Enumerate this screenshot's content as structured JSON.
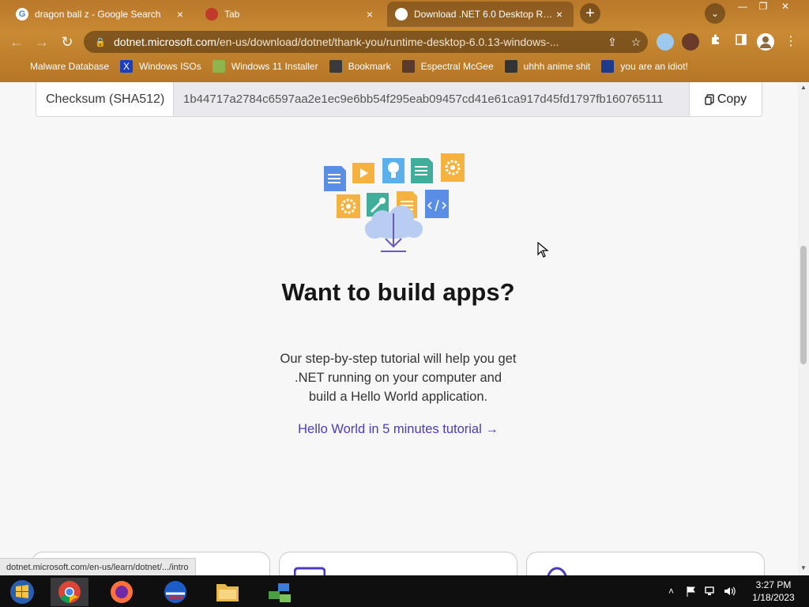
{
  "browser": {
    "tabs": [
      {
        "title": "dragon ball z - Google Search",
        "close": "×",
        "favicon": "google-icon"
      },
      {
        "title": "Tab",
        "close": "×",
        "favicon": "generic-site-icon"
      },
      {
        "title": "Download .NET 6.0 Desktop Runtim",
        "close": "×",
        "favicon": "microsoft-icon",
        "active": true
      }
    ],
    "new_tab": "+",
    "tab_search": "⌄",
    "window_controls": {
      "minimize": "—",
      "restore": "❐",
      "close": "✕"
    },
    "nav": {
      "back": "←",
      "forward": "→",
      "reload": "↻"
    },
    "address": {
      "domain": "dotnet.microsoft.com",
      "path": "/en-us/download/dotnet/thank-you/runtime-desktop-6.0.13-windows-..."
    },
    "omnibox_icons": {
      "share": "⇪",
      "star": "☆"
    },
    "bookmarks": [
      {
        "label": "Malware Database"
      },
      {
        "label": "Windows ISOs"
      },
      {
        "label": "Windows 11 Installer"
      },
      {
        "label": "Bookmark"
      },
      {
        "label": "Espectral McGee"
      },
      {
        "label": "uhhh anime shit"
      },
      {
        "label": "you are an idiot!"
      }
    ]
  },
  "page": {
    "checksum": {
      "label": "Checksum (SHA512)",
      "value": "1b44717a2784c6597aa2e1ec9e6bb54f295eab09457cd41e61ca917d45fd1797fb160765111",
      "copy_label": "Copy"
    },
    "headline": "Want to build apps?",
    "body": "Our step-by-step tutorial will help you get .NET running on your computer and build a Hello World application.",
    "tutorial_link": "Hello World in 5 minutes tutorial →"
  },
  "status_url": "dotnet.microsoft.com/en-us/learn/dotnet/.../intro",
  "taskbar": {
    "tray": {
      "chevron": "˄"
    },
    "clock": {
      "time": "3:27 PM",
      "date": "1/18/2023"
    }
  }
}
